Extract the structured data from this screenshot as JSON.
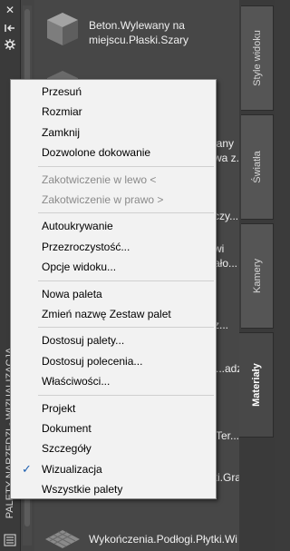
{
  "palette": {
    "title": "PALETY NARZĘDZI - WIZUALIZACJA",
    "controls": [
      "close-icon",
      "autohide-icon",
      "properties-icon"
    ]
  },
  "items": [
    {
      "name": "Beton.Wylewany na miejscu.Płaski.Szary"
    },
    {
      "name": ""
    },
    {
      "name": "...iany\n...wa z..."
    },
    {
      "name": "...czy..."
    },
    {
      "name": "...wi\n...ało..."
    },
    {
      "name": "...z..."
    },
    {
      "name": "...adzi"
    },
    {
      "name": "...Ter..."
    },
    {
      "name": "...ki.Gra"
    },
    {
      "name": "Wykończenia.Podłogi.Płytki.Wi"
    }
  ],
  "tabs": [
    {
      "label": "Style widoku"
    },
    {
      "label": "Światła"
    },
    {
      "label": "Kamery"
    },
    {
      "label": "Materiały"
    }
  ],
  "menu": {
    "groups": [
      [
        {
          "label": "Przesuń",
          "disabled": false
        },
        {
          "label": "Rozmiar",
          "disabled": false
        },
        {
          "label": "Zamknij",
          "disabled": false
        },
        {
          "label": "Dozwolone dokowanie",
          "disabled": false
        }
      ],
      [
        {
          "label": "Zakotwiczenie w lewo  <",
          "disabled": true
        },
        {
          "label": "Zakotwiczenie w prawo  >",
          "disabled": true
        }
      ],
      [
        {
          "label": "Autoukrywanie",
          "disabled": false
        },
        {
          "label": "Przezroczystość...",
          "disabled": false
        },
        {
          "label": "Opcje widoku...",
          "disabled": false
        }
      ],
      [
        {
          "label": "Nowa paleta",
          "disabled": false
        },
        {
          "label": "Zmień nazwę Zestaw palet",
          "disabled": false
        }
      ],
      [
        {
          "label": "Dostosuj palety...",
          "disabled": false
        },
        {
          "label": "Dostosuj polecenia...",
          "disabled": false
        },
        {
          "label": "Właściwości...",
          "disabled": false
        }
      ],
      [
        {
          "label": "Projekt",
          "disabled": false
        },
        {
          "label": "Dokument",
          "disabled": false
        },
        {
          "label": "Szczegóły",
          "disabled": false
        },
        {
          "label": "Wizualizacja",
          "disabled": false,
          "checked": true
        },
        {
          "label": "Wszystkie palety",
          "disabled": false
        }
      ]
    ]
  }
}
